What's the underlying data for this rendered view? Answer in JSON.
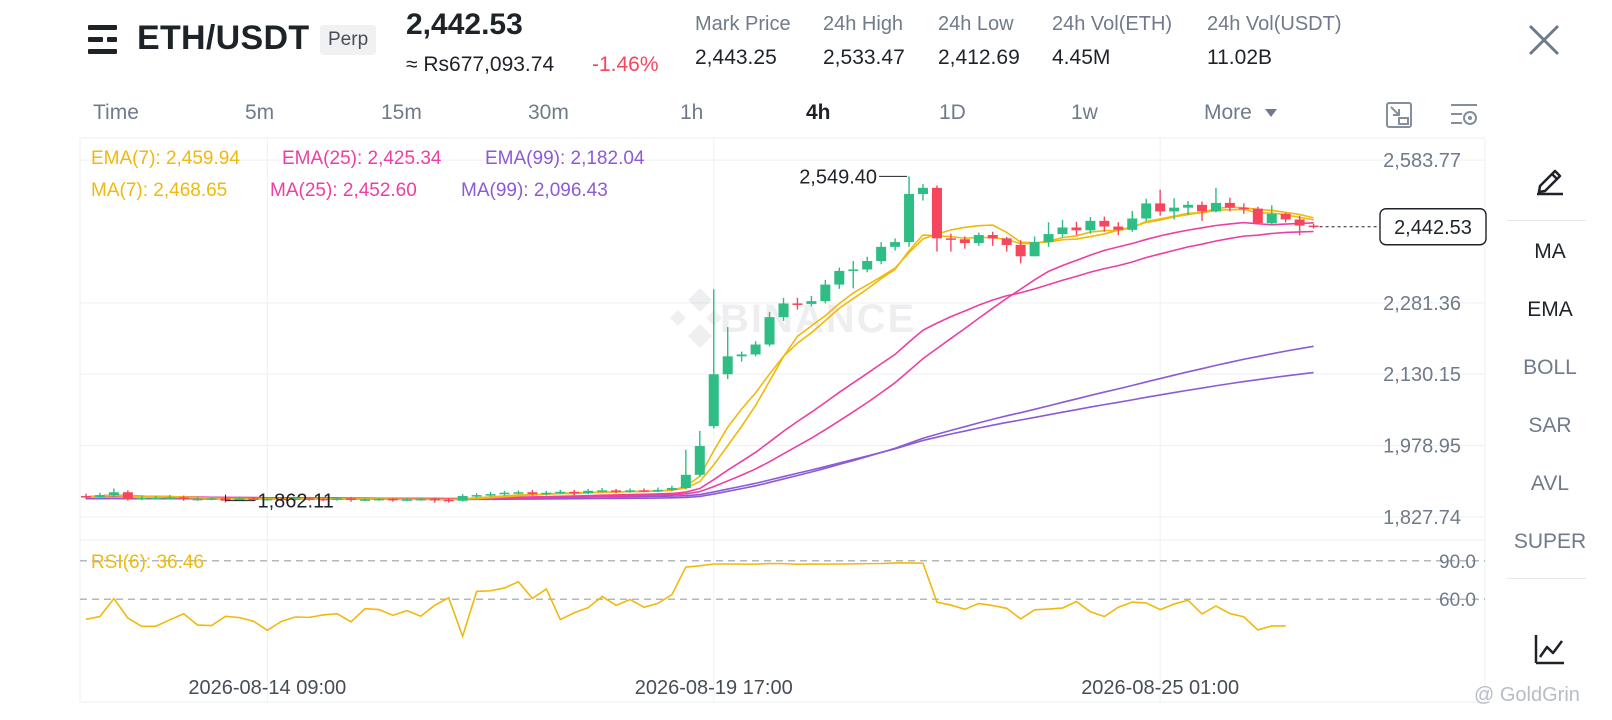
{
  "header": {
    "pair": "ETH/USDT",
    "contract_badge": "Perp",
    "last_price": "2,442.53",
    "fiat_price": "≈ Rs677,093.74",
    "change_pct": "-1.46%",
    "stats": [
      {
        "label": "Mark Price",
        "value": "2,443.25"
      },
      {
        "label": "24h High",
        "value": "2,533.47"
      },
      {
        "label": "24h Low",
        "value": "2,412.69"
      },
      {
        "label": "24h Vol(ETH)",
        "value": "4.45M"
      },
      {
        "label": "24h Vol(USDT)",
        "value": "11.02B"
      }
    ]
  },
  "intervals": {
    "items": [
      "Time",
      "5m",
      "15m",
      "30m",
      "1h",
      "4h",
      "1D",
      "1w",
      "More"
    ],
    "active": "4h"
  },
  "toolbar_icons": [
    "fullscreen-exit-icon",
    "chart-settings-icon",
    "close-icon",
    "pencil-icon",
    "line-chart-icon",
    "caret-down-icon"
  ],
  "indicator_panel": {
    "items": [
      "MA",
      "EMA",
      "BOLL",
      "SAR",
      "AVL",
      "SUPER"
    ],
    "active": [
      "MA",
      "EMA"
    ]
  },
  "legends": {
    "ema": [
      {
        "label": "EMA(7): 2,459.94",
        "color": "#f0b90b"
      },
      {
        "label": "EMA(25): 2,425.34",
        "color": "#ec3fa4"
      },
      {
        "label": "EMA(99): 2,182.04",
        "color": "#8c5ad6"
      }
    ],
    "ma": [
      {
        "label": "MA(7): 2,468.65",
        "color": "#f0b90b"
      },
      {
        "label": "MA(25): 2,452.60",
        "color": "#ec3fa4"
      },
      {
        "label": "MA(99): 2,096.43",
        "color": "#8c5ad6"
      }
    ],
    "rsi": {
      "label": "RSI(6): 36.46",
      "color": "#f0b90b"
    }
  },
  "colors": {
    "up": "#2ebd85",
    "down": "#f6465d",
    "grid": "#eef0f2",
    "axis_text": "#707a8a",
    "brand_yellow": "#f0b90b"
  },
  "watermark": "BINANCE",
  "source_tag": "@ GoldGrin",
  "chart_data": [
    {
      "type": "candlestick",
      "xlabel_ticks": [
        "2026-08-14 09:00",
        "2026-08-19 17:00",
        "2026-08-25 01:00"
      ],
      "price_axis_ticks": [
        2583.77,
        2281.36,
        2130.15,
        1978.95,
        1827.74
      ],
      "ylim": [
        1800,
        2620
      ],
      "current_price": 2442.53,
      "current_price_label": "2,442.53",
      "high_annotation": {
        "label": "2,549.40",
        "value": 2549.4
      },
      "low_annotation": {
        "label": "1,862.11",
        "value": 1862.11
      },
      "candles": [
        [
          1872,
          1870,
          1877,
          1866
        ],
        [
          1870,
          1874,
          1879,
          1866
        ],
        [
          1874,
          1880,
          1888,
          1869
        ],
        [
          1880,
          1866,
          1884,
          1862
        ],
        [
          1866,
          1868,
          1873,
          1863
        ],
        [
          1868,
          1868,
          1872,
          1865
        ],
        [
          1868,
          1869,
          1874,
          1865
        ],
        [
          1869,
          1866,
          1873,
          1862
        ],
        [
          1866,
          1866,
          1871,
          1862
        ],
        [
          1866,
          1867,
          1871,
          1863
        ],
        [
          1867,
          1862,
          1870,
          1858
        ],
        [
          1862,
          1867,
          1871,
          1862
        ],
        [
          1867,
          1866,
          1870,
          1862
        ],
        [
          1866,
          1866,
          1870,
          1862
        ],
        [
          1866,
          1865,
          1869,
          1861
        ],
        [
          1865,
          1867,
          1870,
          1862
        ],
        [
          1867,
          1866,
          1870,
          1862
        ],
        [
          1866,
          1865,
          1869,
          1861
        ],
        [
          1865,
          1867,
          1870,
          1862
        ],
        [
          1867,
          1864,
          1870,
          1860
        ],
        [
          1864,
          1865,
          1868,
          1861
        ],
        [
          1865,
          1866,
          1869,
          1862
        ],
        [
          1866,
          1864,
          1869,
          1860
        ],
        [
          1864,
          1865,
          1868,
          1861
        ],
        [
          1865,
          1866,
          1869,
          1862
        ],
        [
          1866,
          1864,
          1869,
          1858
        ],
        [
          1864,
          1862,
          1868,
          1858
        ],
        [
          1862,
          1872,
          1876,
          1860
        ],
        [
          1872,
          1874,
          1878,
          1869
        ],
        [
          1874,
          1876,
          1881,
          1871
        ],
        [
          1876,
          1879,
          1883,
          1873
        ],
        [
          1879,
          1880,
          1884,
          1876
        ],
        [
          1880,
          1876,
          1885,
          1873
        ],
        [
          1876,
          1879,
          1883,
          1873
        ],
        [
          1879,
          1881,
          1885,
          1876
        ],
        [
          1881,
          1878,
          1885,
          1873
        ],
        [
          1878,
          1883,
          1887,
          1876
        ],
        [
          1883,
          1884,
          1889,
          1880
        ],
        [
          1884,
          1882,
          1887,
          1878
        ],
        [
          1882,
          1884,
          1888,
          1879
        ],
        [
          1884,
          1883,
          1888,
          1880
        ],
        [
          1883,
          1885,
          1890,
          1880
        ],
        [
          1885,
          1889,
          1894,
          1882
        ],
        [
          1889,
          1917,
          1970,
          1886
        ],
        [
          1917,
          1978,
          2010,
          1913
        ],
        [
          2020,
          2130,
          2310,
          2015
        ],
        [
          2130,
          2168,
          2230,
          2120
        ],
        [
          2168,
          2172,
          2178,
          2157
        ],
        [
          2172,
          2193,
          2200,
          2168
        ],
        [
          2193,
          2251,
          2262,
          2189
        ],
        [
          2251,
          2280,
          2292,
          2243
        ],
        [
          2280,
          2279,
          2292,
          2267
        ],
        [
          2279,
          2285,
          2296,
          2274
        ],
        [
          2285,
          2320,
          2330,
          2280
        ],
        [
          2320,
          2349,
          2356,
          2311
        ],
        [
          2349,
          2352,
          2370,
          2312
        ],
        [
          2352,
          2370,
          2379,
          2346
        ],
        [
          2370,
          2400,
          2410,
          2363
        ],
        [
          2400,
          2410,
          2418,
          2392
        ],
        [
          2410,
          2512,
          2549.4,
          2400
        ],
        [
          2512,
          2525,
          2533,
          2498
        ],
        [
          2525,
          2418,
          2530,
          2390
        ],
        [
          2418,
          2416,
          2428,
          2390
        ],
        [
          2416,
          2408,
          2422,
          2396
        ],
        [
          2408,
          2425,
          2430,
          2402
        ],
        [
          2425,
          2418,
          2432,
          2402
        ],
        [
          2418,
          2404,
          2421,
          2390
        ],
        [
          2404,
          2380,
          2414,
          2365
        ],
        [
          2380,
          2410,
          2422,
          2380
        ],
        [
          2410,
          2427,
          2452,
          2400
        ],
        [
          2427,
          2441,
          2457,
          2420
        ],
        [
          2441,
          2435,
          2453,
          2425
        ],
        [
          2435,
          2455,
          2463,
          2428
        ],
        [
          2455,
          2443,
          2464,
          2432
        ],
        [
          2443,
          2436,
          2452,
          2425
        ],
        [
          2436,
          2460,
          2476,
          2432
        ],
        [
          2460,
          2492,
          2502,
          2455
        ],
        [
          2492,
          2475,
          2521,
          2466
        ],
        [
          2475,
          2483,
          2503,
          2458
        ],
        [
          2483,
          2489,
          2497,
          2468
        ],
        [
          2489,
          2475,
          2496,
          2455
        ],
        [
          2475,
          2493,
          2525,
          2473
        ],
        [
          2493,
          2483,
          2504,
          2475
        ],
        [
          2483,
          2481,
          2492,
          2470
        ],
        [
          2481,
          2450,
          2485,
          2448
        ],
        [
          2450,
          2470,
          2488,
          2445
        ],
        [
          2470,
          2458,
          2472,
          2452
        ],
        [
          2458,
          2445,
          2466,
          2424
        ],
        [
          2445,
          2442.53,
          2449,
          2439
        ]
      ]
    },
    {
      "type": "line",
      "name": "RSI(6)",
      "ylim": [
        0,
        100
      ],
      "ticks": [
        90.0,
        60.0
      ],
      "tick_labels": [
        "90.0",
        "60.0"
      ],
      "values": [
        44.3,
        46.5,
        60.5,
        45.3,
        38.7,
        38.9,
        43.8,
        48.6,
        39.8,
        39.4,
        46.6,
        45.6,
        42.8,
        35.7,
        42.6,
        46.1,
        45.8,
        47.7,
        48.7,
        42.3,
        52.6,
        51.9,
        47.4,
        51.1,
        46.7,
        55.3,
        61.1,
        31.0,
        66.1,
        66.6,
        68.8,
        73.6,
        60.6,
        68.0,
        44.1,
        49.4,
        53.4,
        62.1,
        55.2,
        59.8,
        53.7,
        56.8,
        63.5,
        85.1,
        86.1,
        87.5,
        87.5,
        87.4,
        87.4,
        87.9,
        87.8,
        87.3,
        87.5,
        87.4,
        87.5,
        87.6,
        87.8,
        87.9,
        88.3,
        88.3,
        88.1,
        57.7,
        55.4,
        52.1,
        56.7,
        55.0,
        52.9,
        44.6,
        51.7,
        52.3,
        53.1,
        58.2,
        50.2,
        46.5,
        53.7,
        57.7,
        57.1,
        51.9,
        56.2,
        59.2,
        48.5,
        54.7,
        48.8,
        46.2,
        36.0,
        39.1,
        39.1
      ]
    }
  ]
}
